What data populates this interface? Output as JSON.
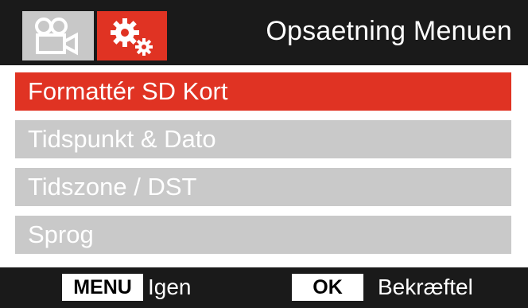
{
  "header": {
    "title": "Opsaetning Menuen",
    "tabs": [
      {
        "icon": "video-camera-icon",
        "active": false
      },
      {
        "icon": "gears-icon",
        "active": true
      }
    ]
  },
  "menu": {
    "items": [
      {
        "label": "Formattér SD Kort",
        "selected": true
      },
      {
        "label": "Tidspunkt & Dato",
        "selected": false
      },
      {
        "label": "Tidszone / DST",
        "selected": false
      },
      {
        "label": "Sprog",
        "selected": false
      }
    ]
  },
  "footer": {
    "menu_key": "MENU",
    "menu_action": "Igen",
    "ok_key": "OK",
    "ok_action": "Bekræftel"
  },
  "colors": {
    "accent": "#e03323",
    "inactive_item": "#c9c9c9",
    "background": "#1a1a1a"
  }
}
